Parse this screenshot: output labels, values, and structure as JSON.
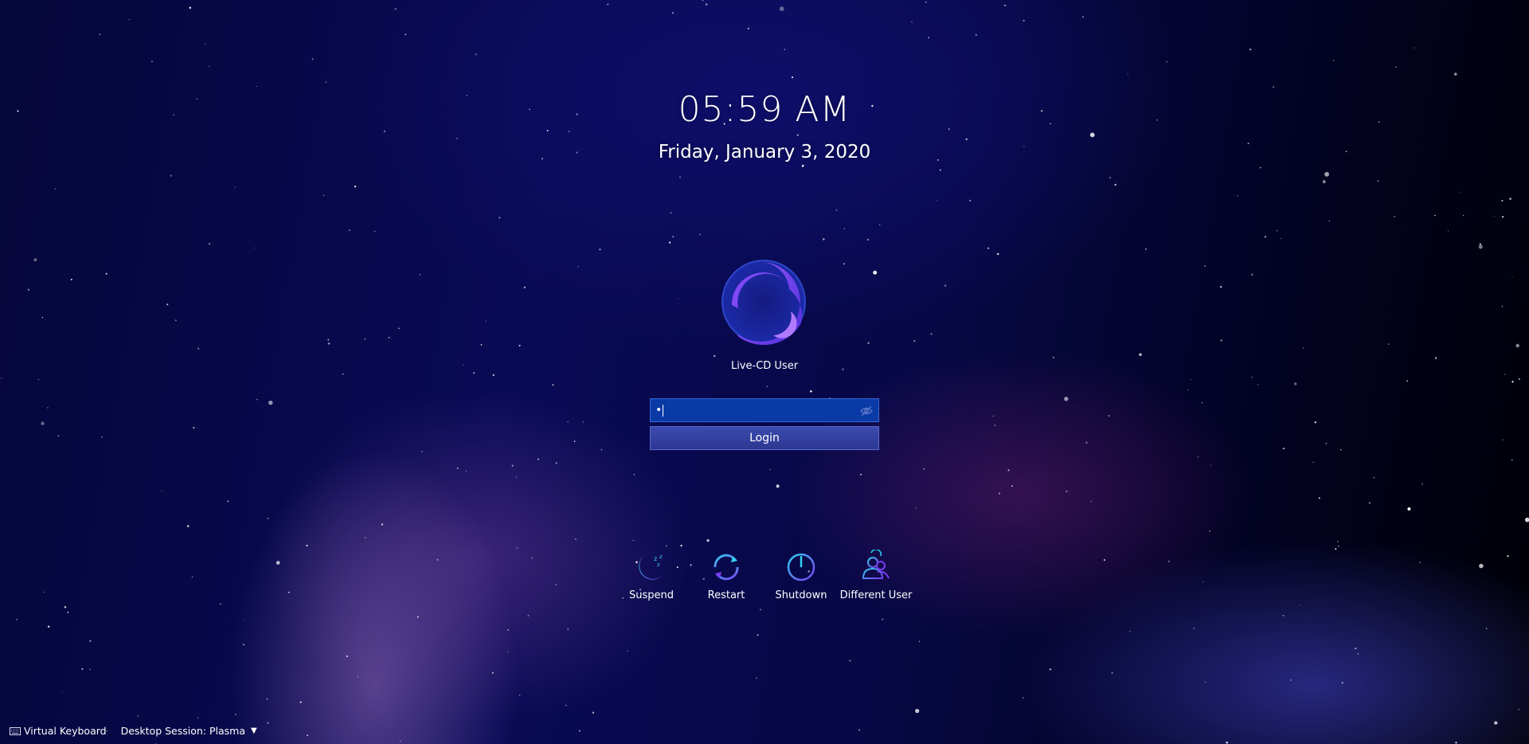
{
  "clock": {
    "time": "05:59 AM",
    "date": "Friday, January 3, 2020"
  },
  "user": {
    "name": "Live-CD User",
    "avatar_icon": "crescent-logo-icon"
  },
  "password": {
    "masked_value": "•",
    "reveal_icon": "eye-hidden-icon"
  },
  "login": {
    "label": "Login"
  },
  "actions": [
    {
      "label": "Suspend",
      "icon": "suspend-icon"
    },
    {
      "label": "Restart",
      "icon": "restart-icon"
    },
    {
      "label": "Shutdown",
      "icon": "shutdown-icon"
    },
    {
      "label": "Different User",
      "icon": "different-user-icon"
    }
  ],
  "bottom_bar": {
    "virtual_keyboard": "Virtual Keyboard",
    "session": "Desktop Session: Plasma",
    "keyboard_icon": "keyboard-icon",
    "session_dropdown_icon": "chevron-down-icon"
  },
  "colors": {
    "accent": "#7a3cf0",
    "field_bg": "#0a3aa6",
    "button_bg": "#3c4bb0",
    "icon_cyan": "#2fb8f0"
  }
}
